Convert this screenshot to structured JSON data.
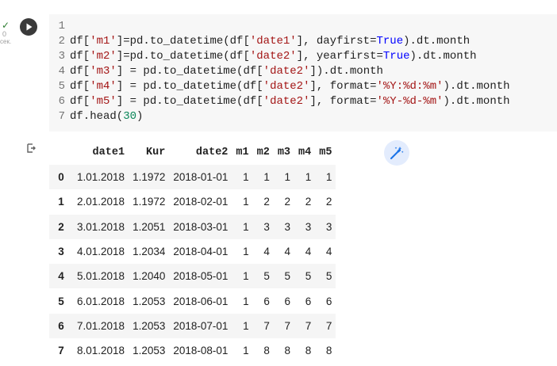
{
  "status": {
    "check": "✓",
    "elapsed": "0",
    "unit": "сек."
  },
  "code": {
    "lines": [
      {
        "n": "1",
        "tokens": []
      },
      {
        "n": "2",
        "tokens": [
          {
            "t": "df[",
            "c": "def"
          },
          {
            "t": "'m1'",
            "c": "str"
          },
          {
            "t": "]=pd.to_datetime(df[",
            "c": "def"
          },
          {
            "t": "'date1'",
            "c": "str"
          },
          {
            "t": "], dayfirst=",
            "c": "def"
          },
          {
            "t": "True",
            "c": "kw"
          },
          {
            "t": ").dt.month",
            "c": "def"
          }
        ]
      },
      {
        "n": "3",
        "tokens": [
          {
            "t": "df[",
            "c": "def"
          },
          {
            "t": "'m2'",
            "c": "str"
          },
          {
            "t": "]=pd.to_datetime(df[",
            "c": "def"
          },
          {
            "t": "'date2'",
            "c": "str"
          },
          {
            "t": "], yearfirst=",
            "c": "def"
          },
          {
            "t": "True",
            "c": "kw"
          },
          {
            "t": ").dt.month",
            "c": "def"
          }
        ]
      },
      {
        "n": "4",
        "tokens": [
          {
            "t": "df[",
            "c": "def"
          },
          {
            "t": "'m3'",
            "c": "str"
          },
          {
            "t": "] = pd.to_datetime(df[",
            "c": "def"
          },
          {
            "t": "'date2'",
            "c": "str"
          },
          {
            "t": "]).dt.month",
            "c": "def"
          }
        ]
      },
      {
        "n": "5",
        "tokens": [
          {
            "t": "df[",
            "c": "def"
          },
          {
            "t": "'m4'",
            "c": "str"
          },
          {
            "t": "] = pd.to_datetime(df[",
            "c": "def"
          },
          {
            "t": "'date2'",
            "c": "str"
          },
          {
            "t": "], format=",
            "c": "def"
          },
          {
            "t": "'%Y:%d:%m'",
            "c": "str"
          },
          {
            "t": ").dt.month",
            "c": "def"
          }
        ]
      },
      {
        "n": "6",
        "tokens": [
          {
            "t": "df[",
            "c": "def"
          },
          {
            "t": "'m5'",
            "c": "str"
          },
          {
            "t": "] = pd.to_datetime(df[",
            "c": "def"
          },
          {
            "t": "'date2'",
            "c": "str"
          },
          {
            "t": "], format=",
            "c": "def"
          },
          {
            "t": "'%Y-%d-%m'",
            "c": "str"
          },
          {
            "t": ").dt.month",
            "c": "def"
          }
        ]
      },
      {
        "n": "7",
        "tokens": [
          {
            "t": "df.head(",
            "c": "def"
          },
          {
            "t": "30",
            "c": "num"
          },
          {
            "t": ")",
            "c": "def"
          }
        ]
      }
    ]
  },
  "table": {
    "columns": [
      "date1",
      "Kur",
      "date2",
      "m1",
      "m2",
      "m3",
      "m4",
      "m5"
    ],
    "rows": [
      {
        "index": "0",
        "cells": [
          "1.01.2018",
          "1.1972",
          "2018-01-01",
          "1",
          "1",
          "1",
          "1",
          "1"
        ]
      },
      {
        "index": "1",
        "cells": [
          "2.01.2018",
          "1.1972",
          "2018-02-01",
          "1",
          "2",
          "2",
          "2",
          "2"
        ]
      },
      {
        "index": "2",
        "cells": [
          "3.01.2018",
          "1.2051",
          "2018-03-01",
          "1",
          "3",
          "3",
          "3",
          "3"
        ]
      },
      {
        "index": "3",
        "cells": [
          "4.01.2018",
          "1.2034",
          "2018-04-01",
          "1",
          "4",
          "4",
          "4",
          "4"
        ]
      },
      {
        "index": "4",
        "cells": [
          "5.01.2018",
          "1.2040",
          "2018-05-01",
          "1",
          "5",
          "5",
          "5",
          "5"
        ]
      },
      {
        "index": "5",
        "cells": [
          "6.01.2018",
          "1.2053",
          "2018-06-01",
          "1",
          "6",
          "6",
          "6",
          "6"
        ]
      },
      {
        "index": "6",
        "cells": [
          "7.01.2018",
          "1.2053",
          "2018-07-01",
          "1",
          "7",
          "7",
          "7",
          "7"
        ]
      },
      {
        "index": "7",
        "cells": [
          "8.01.2018",
          "1.2053",
          "2018-08-01",
          "1",
          "8",
          "8",
          "8",
          "8"
        ]
      }
    ]
  },
  "icons": {
    "run": "play-icon",
    "output": "output-icon",
    "wand": "magic-wand-icon"
  },
  "colors": {
    "check": "#2e7d32",
    "run_bg": "#3a3a3a",
    "wand_bg": "#e3ecfd",
    "wand_fg": "#1a73e8",
    "string": "#a31515",
    "keyword": "#0000ff",
    "number": "#098658"
  }
}
